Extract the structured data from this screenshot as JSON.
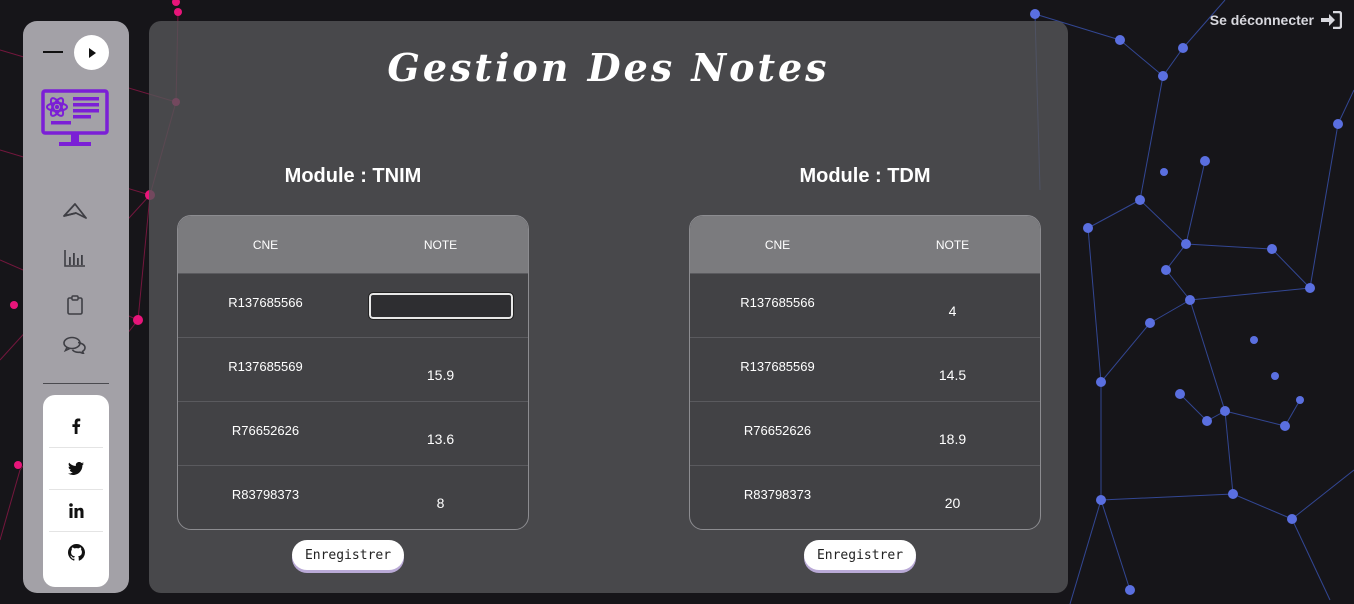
{
  "header": {
    "logout_label": "Se déconnecter"
  },
  "page": {
    "title": "Gestion Des Notes"
  },
  "sidebar": {
    "nav_icons": [
      "paper-plane-icon",
      "bar-chart-icon",
      "clipboard-icon",
      "comments-icon"
    ],
    "social_icons": [
      "facebook-icon",
      "twitter-icon",
      "linkedin-icon",
      "github-icon"
    ]
  },
  "modules": [
    {
      "title": "Module : TNIM",
      "columns": [
        "CNE",
        "NOTE"
      ],
      "rows": [
        {
          "cne": "R137685566",
          "note": ""
        },
        {
          "cne": "R137685569",
          "note": "15.9"
        },
        {
          "cne": "R76652626",
          "note": "13.6"
        },
        {
          "cne": "R83798373",
          "note": "8"
        }
      ],
      "save_label": "Enregistrer"
    },
    {
      "title": "Module : TDM",
      "columns": [
        "CNE",
        "NOTE"
      ],
      "rows": [
        {
          "cne": "R137685566",
          "note": "4"
        },
        {
          "cne": "R137685569",
          "note": "14.5"
        },
        {
          "cne": "R76652626",
          "note": "18.9"
        },
        {
          "cne": "R83798373",
          "note": "20"
        }
      ],
      "save_label": "Enregistrer"
    }
  ],
  "colors": {
    "accent_purple": "#7b1fd6",
    "pink_network": "#e8157a",
    "blue_network": "#5a6fe0"
  }
}
